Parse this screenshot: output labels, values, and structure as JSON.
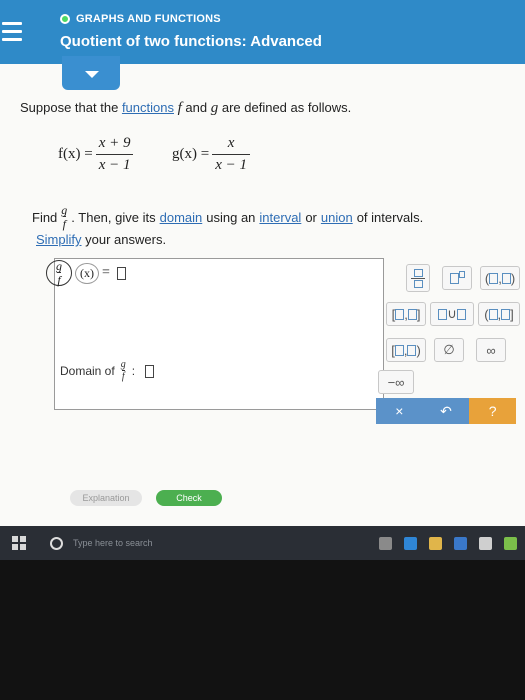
{
  "header": {
    "topic": "GRAPHS AND FUNCTIONS",
    "title": "Quotient of two functions: Advanced"
  },
  "problem": {
    "intro_prefix": "Suppose that the",
    "functions_link": "functions",
    "intro_f": "f",
    "intro_and": "and",
    "intro_g": "g",
    "intro_suffix": "are defined as follows.",
    "f_lhs": "f(x) =",
    "f_num": "x + 9",
    "f_den": "x − 1",
    "g_lhs": "g(x) =",
    "g_num": "x",
    "g_den": "x − 1",
    "find_label": "Find",
    "find_num": "g",
    "find_den": "f",
    "find_mid": ". Then, give its",
    "domain_link": "domain",
    "find_using": "using an",
    "interval_link": "interval",
    "find_or": "or",
    "union_link": "union",
    "find_end": "of intervals.",
    "simplify_link": "Simplify",
    "simplify_rest": "your answers."
  },
  "answer": {
    "circle_num": "g",
    "circle_den": "f",
    "x_label": "(x)",
    "equals": "=",
    "domain_label": "Domain of",
    "domain_num": "g",
    "domain_den": "f",
    "domain_colon": ":"
  },
  "palette": {
    "neg_infinity": "−∞",
    "infinity": "∞",
    "empty_set": "∅",
    "union_symbol": "∪"
  },
  "actions": {
    "clear": "×",
    "undo": "↶",
    "help": "?"
  },
  "buttons": {
    "explanation": "Explanation",
    "check": "Check"
  },
  "taskbar": {
    "search_placeholder": "Type here to search"
  },
  "colors": {
    "header_blue": "#2f8ac8",
    "link_blue": "#2e6db4",
    "check_green": "#4caf50",
    "help_orange": "#e8a23a"
  }
}
